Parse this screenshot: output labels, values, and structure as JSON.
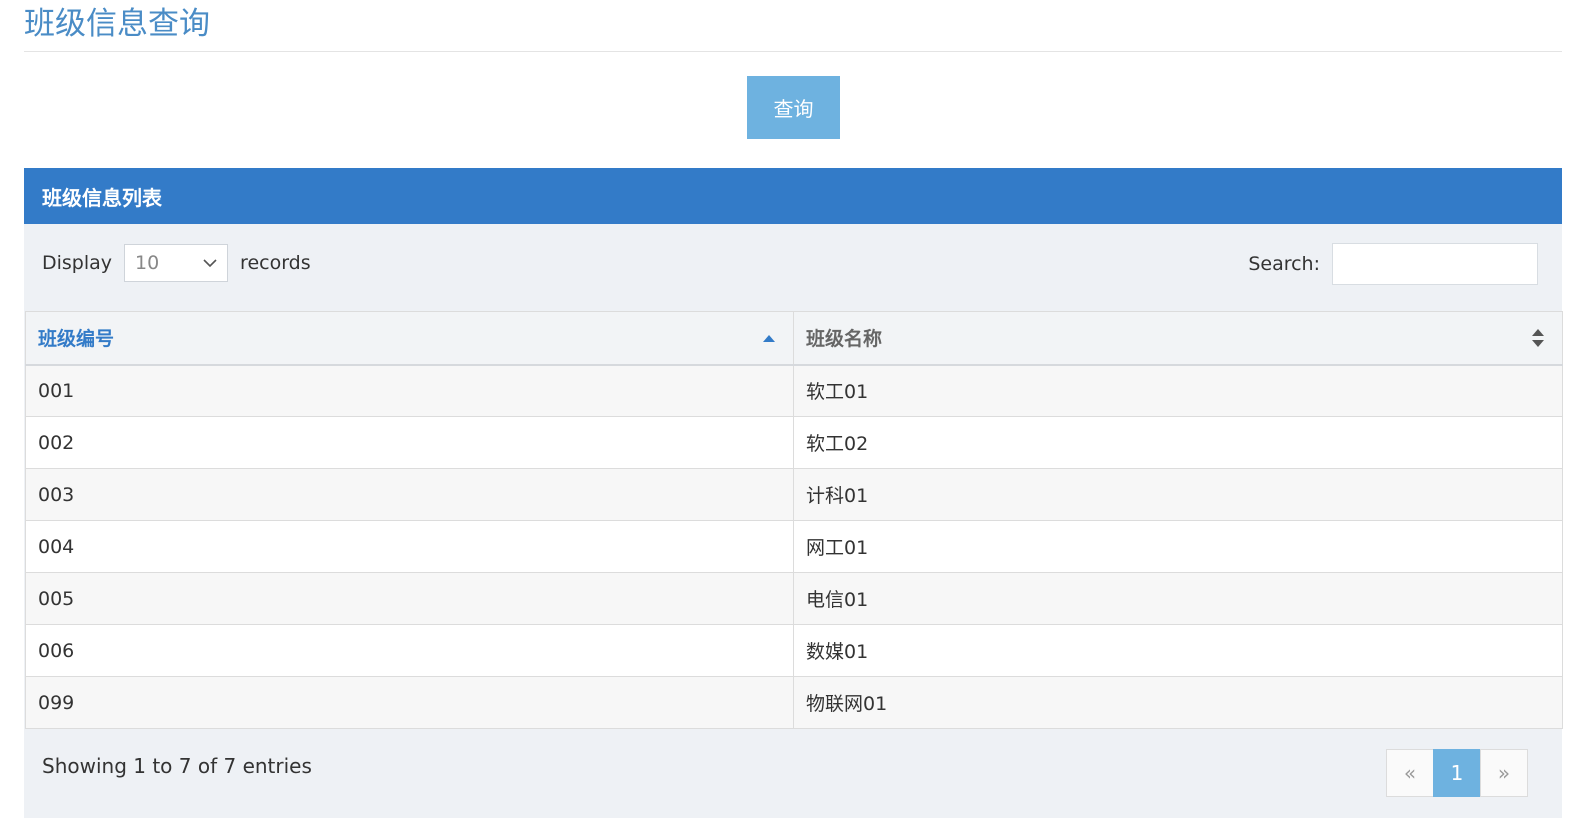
{
  "page": {
    "title": "班级信息查询"
  },
  "actions": {
    "query_label": "查询"
  },
  "panel": {
    "title": "班级信息列表"
  },
  "controls": {
    "display_label": "Display",
    "page_length": "10",
    "records_label": "records",
    "search_label": "Search:",
    "search_value": ""
  },
  "table": {
    "columns": [
      "班级编号",
      "班级名称"
    ],
    "sorted_column": "班级编号",
    "sort_direction": "ascending",
    "rows": [
      {
        "id": "001",
        "name": "软工01"
      },
      {
        "id": "002",
        "name": "软工02"
      },
      {
        "id": "003",
        "name": "计科01"
      },
      {
        "id": "004",
        "name": "网工01"
      },
      {
        "id": "005",
        "name": "电信01"
      },
      {
        "id": "006",
        "name": "数媒01"
      },
      {
        "id": "099",
        "name": "物联网01"
      }
    ]
  },
  "footer": {
    "info": "Showing 1 to 7 of 7 entries"
  },
  "pagination": {
    "prev": "«",
    "current": "1",
    "next": "»"
  },
  "colors": {
    "header_bg": "#337bc8",
    "button_bg": "#6eb2e0",
    "title_color": "#4a8cc6",
    "sorted_header": "#337bc8"
  }
}
